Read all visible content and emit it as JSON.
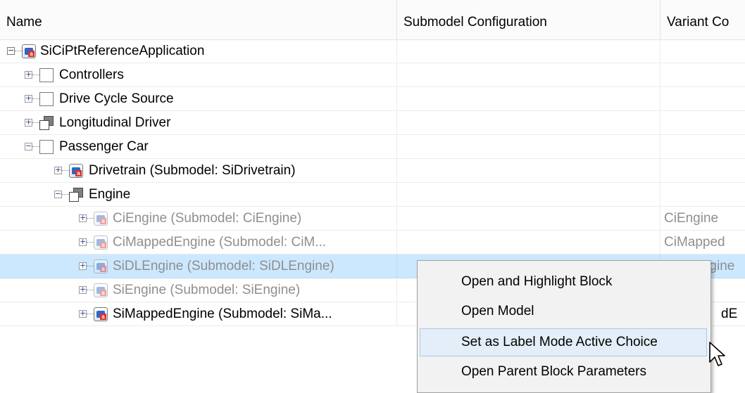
{
  "columns": {
    "name": "Name",
    "submodel_configuration": "Submodel Configuration",
    "variant": "Variant Co"
  },
  "rows": [
    {
      "label": "SiCiPtReferenceApplication",
      "variant": "",
      "expander": "−",
      "icon": "model-reference-icon"
    },
    {
      "label": "Controllers",
      "variant": "",
      "expander": "+",
      "icon": "subsystem-icon"
    },
    {
      "label": "Drive Cycle Source",
      "variant": "",
      "expander": "+",
      "icon": "subsystem-icon"
    },
    {
      "label": "Longitudinal Driver",
      "variant": "",
      "expander": "+",
      "icon": "variant-subsystem-icon"
    },
    {
      "label": "Passenger Car",
      "variant": "",
      "expander": "−",
      "icon": "subsystem-icon"
    },
    {
      "label": "Drivetrain (Submodel: SiDrivetrain)",
      "variant": "",
      "expander": "+",
      "icon": "model-reference-icon"
    },
    {
      "label": "Engine",
      "variant": "",
      "expander": "−",
      "icon": "variant-subsystem-icon"
    },
    {
      "label": "CiEngine (Submodel: CiEngine)",
      "variant": "CiEngine",
      "expander": "+",
      "icon": "model-reference-icon"
    },
    {
      "label": "CiMappedEngine (Submodel: CiM...",
      "variant": "CiMapped",
      "expander": "+",
      "icon": "model-reference-icon"
    },
    {
      "label": "SiDLEngine (Submodel: SiDLEngine)",
      "variant": "SiDLEngine",
      "expander": "+",
      "icon": "model-reference-icon"
    },
    {
      "label": "SiEngine (Submodel: SiEngine)",
      "variant": "",
      "expander": "+",
      "icon": "model-reference-icon"
    },
    {
      "label": "SiMappedEngine (Submodel: SiMa...",
      "variant": "dE",
      "expander": "+",
      "icon": "model-reference-icon"
    }
  ],
  "context_menu": {
    "items": [
      "Open and Highlight Block",
      "Open Model",
      "Set as Label Mode Active Choice",
      "Open Parent Block Parameters"
    ],
    "hovered_index": 2
  },
  "colors": {
    "selection": "#cce8ff",
    "menu_hover": "#e3eef8",
    "inactive_text": "#8f8f8f"
  }
}
